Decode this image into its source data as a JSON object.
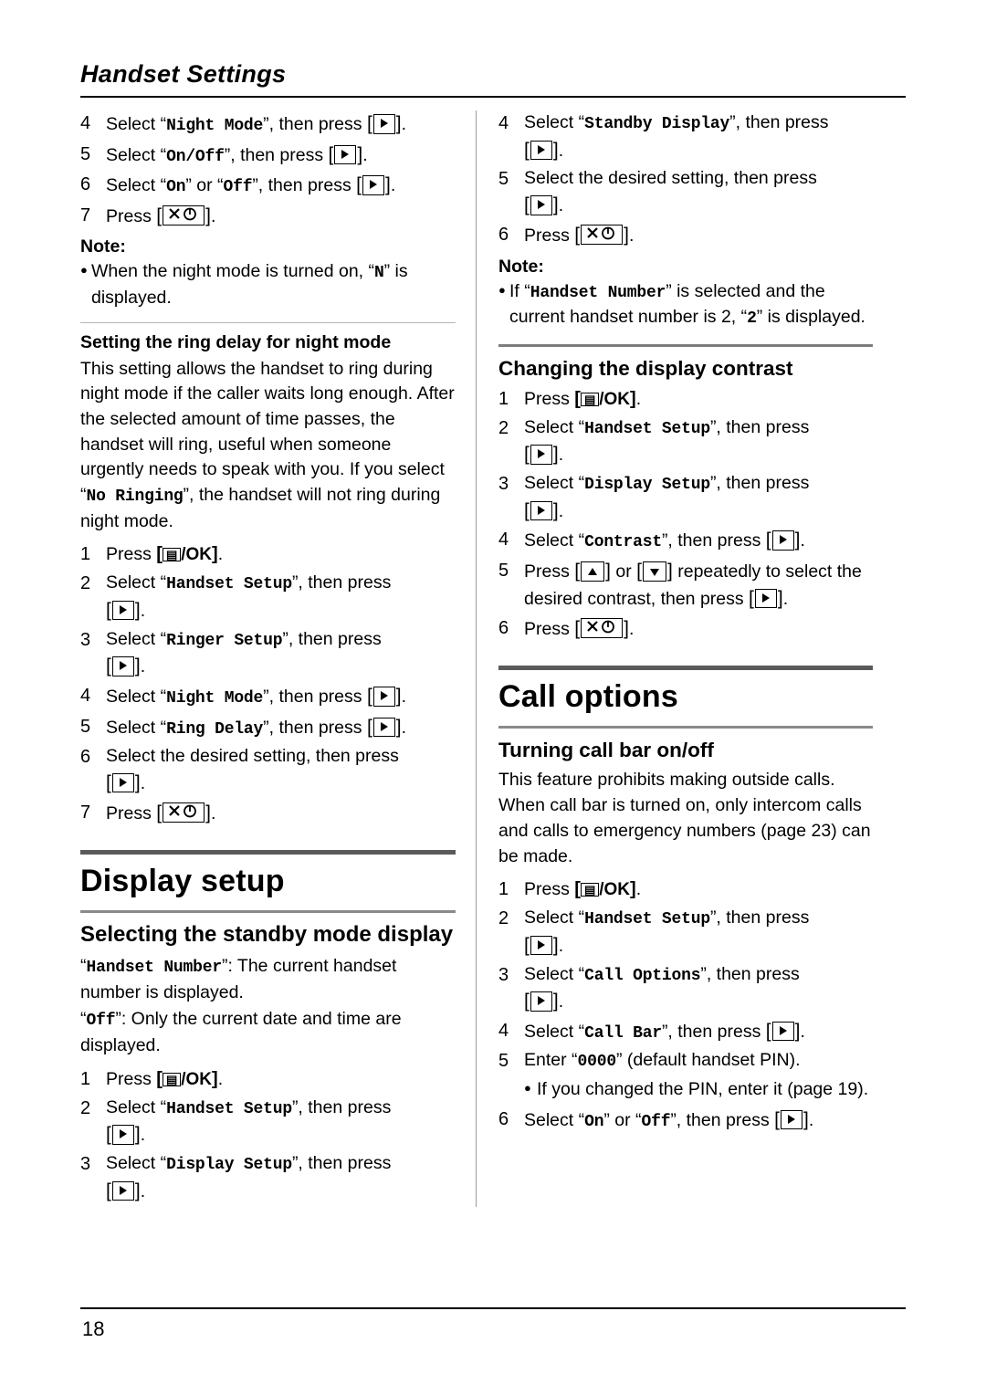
{
  "header": {
    "title": "Handset Settings"
  },
  "page_number": "18",
  "left": {
    "night_mode_steps": [
      {
        "num": "4",
        "pre": "Select “",
        "code": "Night Mode",
        "post": "”, then press ",
        "key": "nav",
        "end": "."
      },
      {
        "num": "5",
        "pre": "Select “",
        "code": "On/Off",
        "post": "”, then press ",
        "key": "nav",
        "end": "."
      },
      {
        "num": "6",
        "pre": "Select “",
        "code": "On",
        "mid": "” or “",
        "code2": "Off",
        "post": "”, then press ",
        "key": "nav",
        "end": "."
      },
      {
        "num": "7",
        "pre": "Press ",
        "key": "power",
        "end": "."
      }
    ],
    "note_label": "Note:",
    "note_bullet": {
      "pre": "When the night mode is turned on, “",
      "code": "N",
      "post": "” is displayed."
    },
    "subhead_ring_delay": "Setting the ring delay for night mode",
    "ring_delay_para1": "This setting allows the handset to ring during night mode if the caller waits long enough. After the selected amount of time passes, the handset will ring, useful when someone urgently needs to speak with you. If you select “",
    "ring_delay_code": "No Ringing",
    "ring_delay_para2": "”, the handset will not ring during night mode.",
    "ring_delay_steps": [
      {
        "num": "1",
        "pre": "Press ",
        "key": "ok",
        "end": "."
      },
      {
        "num": "2",
        "pre": "Select “",
        "code": "Handset Setup",
        "post": "”, then press",
        "key": "nav-next",
        "end": "."
      },
      {
        "num": "3",
        "pre": "Select “",
        "code": "Ringer Setup",
        "post": "”, then press",
        "key": "nav-next",
        "end": "."
      },
      {
        "num": "4",
        "pre": "Select “",
        "code": "Night Mode",
        "post": "”, then press ",
        "key": "nav",
        "end": "."
      },
      {
        "num": "5",
        "pre": "Select “",
        "code": "Ring Delay",
        "post": "”, then press ",
        "key": "nav",
        "end": "."
      },
      {
        "num": "6",
        "pre": "Select the desired setting, then press",
        "key": "nav-next",
        "end": "."
      },
      {
        "num": "7",
        "pre": "Press ",
        "key": "power",
        "end": "."
      }
    ],
    "chapter_display_setup": "Display setup",
    "section_standby": "Selecting the standby mode display",
    "standby_para1_code": "Handset Number",
    "standby_para1_text": ": The current handset number is displayed.",
    "standby_para2_code": "Off",
    "standby_para2_text": ": Only the current date and time are displayed.",
    "standby_steps": [
      {
        "num": "1",
        "pre": "Press ",
        "key": "ok",
        "end": "."
      },
      {
        "num": "2",
        "pre": "Select “",
        "code": "Handset Setup",
        "post": "”, then press",
        "key": "nav-next",
        "end": "."
      },
      {
        "num": "3",
        "pre": "Select “",
        "code": "Display Setup",
        "post": "”, then press",
        "key": "nav-next",
        "end": "."
      }
    ]
  },
  "right": {
    "standby_steps_cont": [
      {
        "num": "4",
        "pre": "Select “",
        "code": "Standby Display",
        "post": "”, then press",
        "key": "nav-next",
        "end": "."
      },
      {
        "num": "5",
        "pre": "Select the desired setting, then press",
        "key": "nav-next",
        "end": "."
      },
      {
        "num": "6",
        "pre": "Press ",
        "key": "power",
        "end": "."
      }
    ],
    "note_label": "Note:",
    "note_bullet": {
      "pre": "If “",
      "code": "Handset Number",
      "mid": "” is selected and the current handset number is 2, “",
      "code2": "2",
      "post": "” is displayed."
    },
    "section_contrast": "Changing the display contrast",
    "contrast_steps": [
      {
        "num": "1",
        "pre": "Press ",
        "key": "ok",
        "end": "."
      },
      {
        "num": "2",
        "pre": "Select “",
        "code": "Handset Setup",
        "post": "”, then press",
        "key": "nav-next",
        "end": "."
      },
      {
        "num": "3",
        "pre": "Select “",
        "code": "Display Setup",
        "post": "”, then press",
        "key": "nav-next",
        "end": "."
      },
      {
        "num": "4",
        "pre": "Select “",
        "code": "Contrast",
        "post": "”, then press ",
        "key": "nav",
        "end": "."
      },
      {
        "num": "5",
        "pre": "Press ",
        "key": "updown",
        "mid": " repeatedly to select the desired contrast, then press ",
        "key2": "nav",
        "end": "."
      },
      {
        "num": "6",
        "pre": "Press ",
        "key": "power",
        "end": "."
      }
    ],
    "chapter_call_options": "Call options",
    "section_call_bar": "Turning call bar on/off",
    "call_bar_para": "This feature prohibits making outside calls. When call bar is turned on, only intercom calls and calls to emergency numbers (page 23) can be made.",
    "call_bar_steps": [
      {
        "num": "1",
        "pre": "Press ",
        "key": "ok",
        "end": "."
      },
      {
        "num": "2",
        "pre": "Select “",
        "code": "Handset Setup",
        "post": "”, then press",
        "key": "nav-next",
        "end": "."
      },
      {
        "num": "3",
        "pre": "Select “",
        "code": "Call Options",
        "post": "”, then press",
        "key": "nav-next",
        "end": "."
      },
      {
        "num": "4",
        "pre": "Select “",
        "code": "Call Bar",
        "post": "”, then press ",
        "key": "nav",
        "end": "."
      },
      {
        "num": "5",
        "pre": "Enter “",
        "code": "0000",
        "post": "” (default handset PIN)."
      },
      {
        "num": "6",
        "pre": "Select “",
        "code": "On",
        "mid": "” or “",
        "code2": "Off",
        "post": "”, then press ",
        "key": "nav",
        "end": "."
      }
    ],
    "call_bar_sub_bullet": "If you changed the PIN, enter it (page 19)."
  }
}
